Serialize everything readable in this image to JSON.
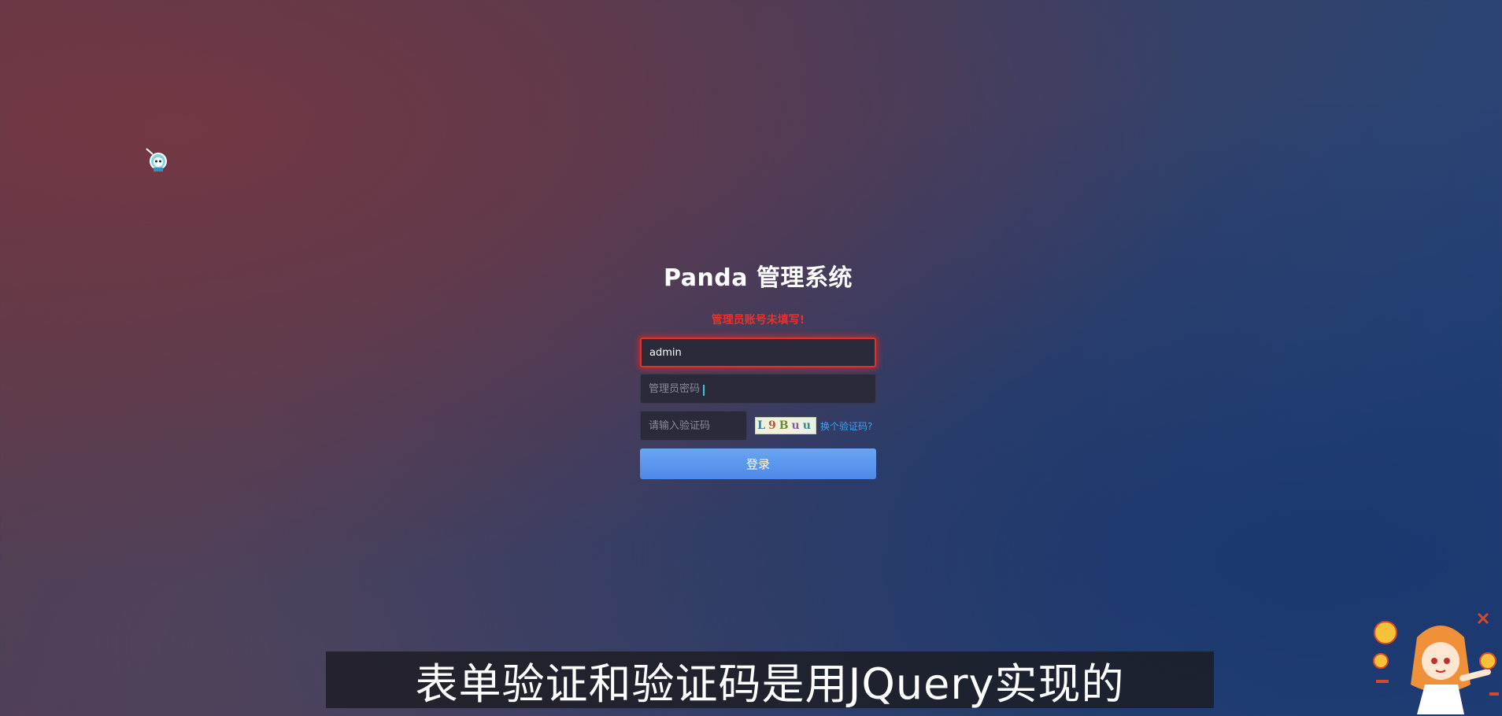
{
  "login": {
    "title": "Panda 管理系统",
    "error_message": "管理员账号未填写!",
    "username_value": "admin",
    "password_placeholder": "管理员密码",
    "captcha_placeholder": "请输入验证码",
    "captcha_chars": [
      "L",
      "9",
      "B",
      "u",
      "u"
    ],
    "refresh_captcha_label": "换个验证码?",
    "submit_label": "登录"
  },
  "subtitle": {
    "text": "表单验证和验证码是用JQuery实现的"
  },
  "colors": {
    "error": "#e8312a",
    "link": "#3ba3f0",
    "button": "#5a95ee"
  },
  "icons": {
    "desktop_icon": "anime-character-icon",
    "watermark": "umaru-mascot-icon"
  }
}
